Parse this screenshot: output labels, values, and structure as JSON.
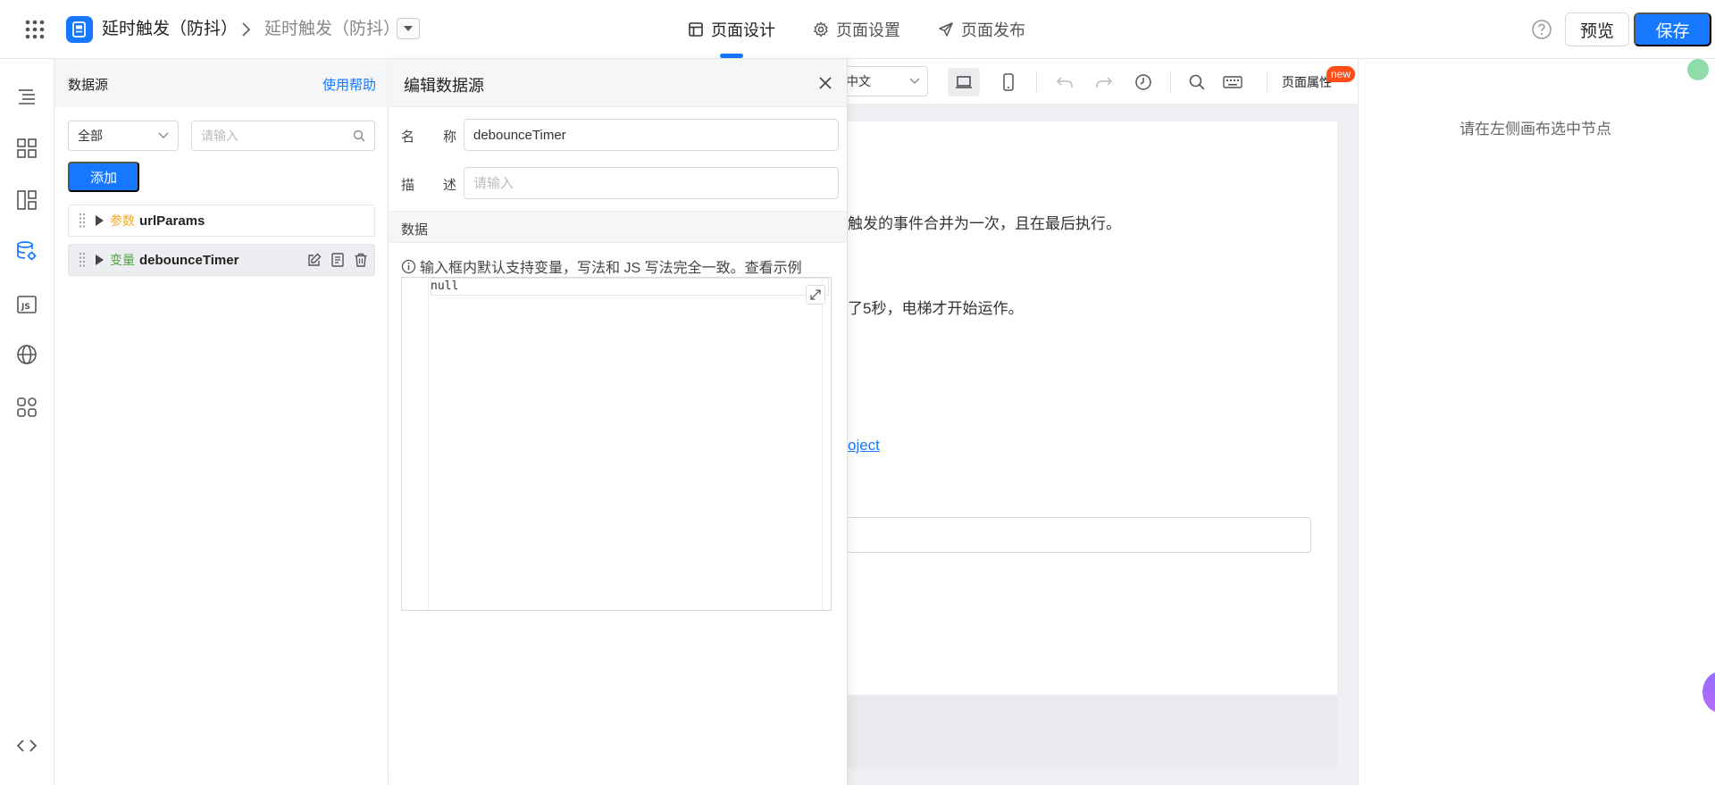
{
  "header": {
    "app_title": "延时触发（防抖）",
    "breadcrumb_page": "延时触发（防抖）",
    "tabs": [
      {
        "label": "页面设计",
        "icon": "layout-icon"
      },
      {
        "label": "页面设置",
        "icon": "gear-icon"
      },
      {
        "label": "页面发布",
        "icon": "send-icon"
      }
    ],
    "preview_label": "预览",
    "save_label": "保存",
    "accent_color": "#1677ff"
  },
  "rail": {
    "icons": [
      "outline-tree-icon",
      "components-icon",
      "layout-panel-icon",
      "datasource-icon",
      "js-icon",
      "globe-icon",
      "apps-icon",
      "code-icon"
    ]
  },
  "datasource": {
    "title": "数据源",
    "help_link": "使用帮助",
    "filter_value": "全部",
    "search_placeholder": "请输入",
    "add_label": "添加",
    "items": [
      {
        "tag": "参数",
        "name": "urlParams"
      },
      {
        "tag": "变量",
        "name": "debounceTimer"
      }
    ]
  },
  "editor": {
    "title": "编辑数据源",
    "name_label_1": "名",
    "name_label_2": "称",
    "name_value": "debounceTimer",
    "desc_label_1": "描",
    "desc_label_2": "述",
    "desc_placeholder": "请输入",
    "data_section": "数据",
    "hint": "输入框内默认支持变量，写法和 JS 写法完全一致。查看示例",
    "code": "null"
  },
  "canvas": {
    "language": "中文",
    "page_props": "页面属性",
    "new_badge": "new",
    "text_line_1": "触发的事件合并为一次，且在最后执行。",
    "text_line_2": "了5秒，电梯才开始运作。",
    "link_fragment": "oject"
  },
  "right_panel": {
    "hint": "请在左侧画布选中节点"
  }
}
